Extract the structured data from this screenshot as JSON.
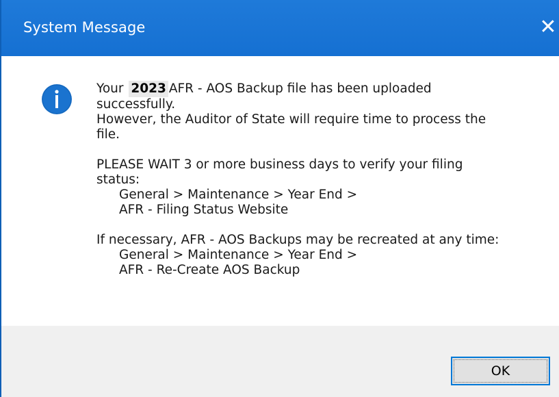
{
  "window": {
    "title": "System Message",
    "close_glyph": "✕"
  },
  "icon": {
    "name": "info-icon",
    "color": "#1a73cf"
  },
  "message": {
    "line1_pre": "Your",
    "year": "2023",
    "line1_post": "AFR - AOS Backup file has been uploaded",
    "line2": "successfully.",
    "line3": "However, the Auditor of State will require time to process the",
    "line4": "file.",
    "line5": "PLEASE WAIT 3 or more business days to verify your filing",
    "line6": "status:",
    "path1_a": "General > Maintenance > Year End >",
    "path1_b": "AFR - Filing Status Website",
    "line7": "If necessary, AFR - AOS Backups may be recreated at any time:",
    "path2_a": "General > Maintenance > Year End >",
    "path2_b": "AFR - Re-Create AOS Backup"
  },
  "buttons": {
    "ok_label": "OK"
  },
  "colors": {
    "titlebar": "#1a74d4",
    "footer": "#f0f0f0",
    "button_border": "#0078d7"
  }
}
